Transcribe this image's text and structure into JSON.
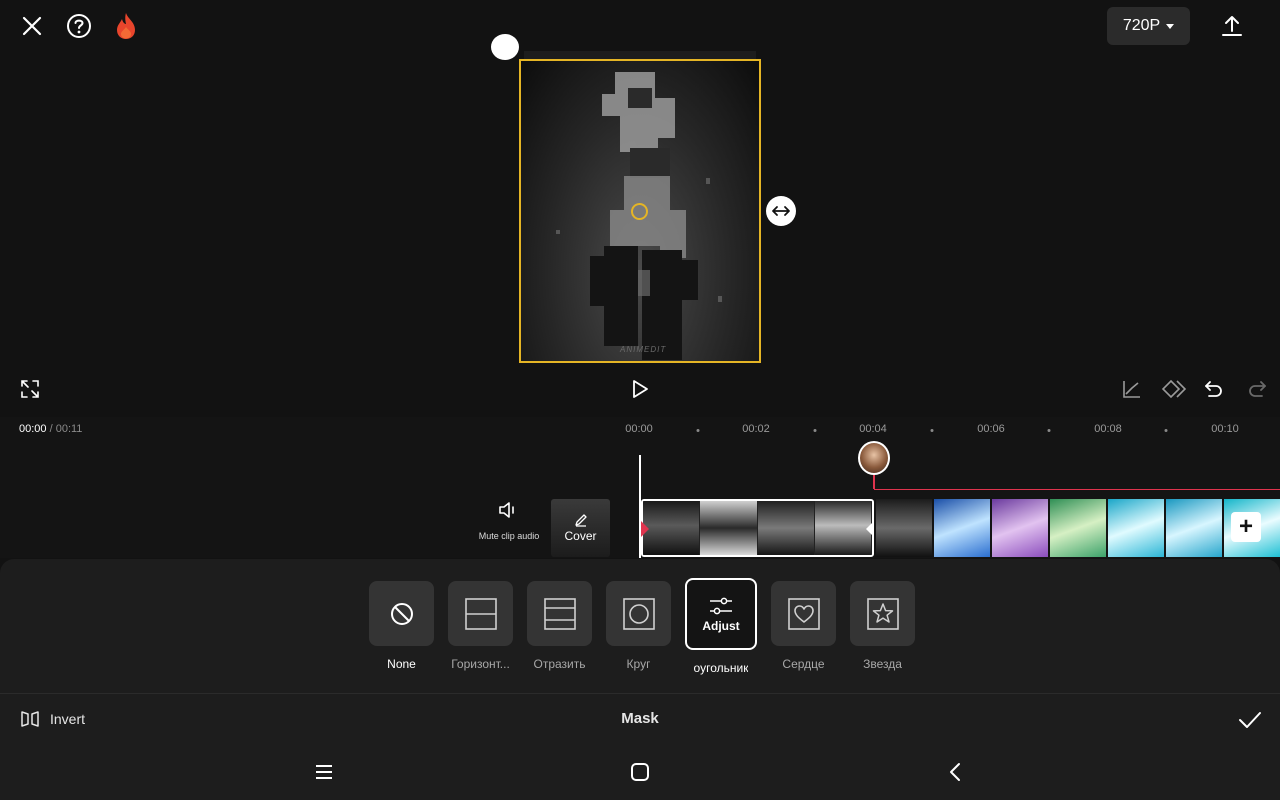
{
  "topbar": {
    "close_icon": "close-icon",
    "help_icon": "help-icon",
    "hot_icon": "flame-icon",
    "resolution": "720P",
    "export_icon": "export-icon"
  },
  "preview": {
    "watermark": "ANIMEDIT"
  },
  "controls": {
    "fullscreen_icon": "fullscreen-icon",
    "play_icon": "play-icon",
    "graph_icon": "curve-icon",
    "keyframe_icon": "keyframe-icon",
    "undo_icon": "undo-icon",
    "redo_icon": "redo-icon"
  },
  "timeline": {
    "current_time": "00:00",
    "separator": " / ",
    "total_time": "00:11",
    "ticks": [
      "00:00",
      "00:02",
      "00:04",
      "00:06",
      "00:08",
      "00:10"
    ],
    "mute_label": "Mute clip audio",
    "cover_label": "Cover",
    "add_label": "+"
  },
  "mask": {
    "title": "Mask",
    "invert_label": "Invert",
    "shapes": [
      {
        "label": "None",
        "icon": "none-icon",
        "active": false,
        "emphasis": true
      },
      {
        "label": "Горизонт...",
        "icon": "horizontal-icon",
        "active": false
      },
      {
        "label": "Отразить",
        "icon": "mirror-icon",
        "active": false
      },
      {
        "label": "Круг",
        "icon": "circle-icon",
        "active": false
      },
      {
        "label": "оугольник",
        "icon": "adjust-icon",
        "active": true,
        "overlay": "Adjust"
      },
      {
        "label": "Сердце",
        "icon": "heart-icon",
        "active": false
      },
      {
        "label": "Звезда",
        "icon": "star-icon",
        "active": false
      }
    ]
  },
  "nav": {
    "recents_icon": "recents-icon",
    "home_icon": "home-icon",
    "back_icon": "back-icon"
  }
}
